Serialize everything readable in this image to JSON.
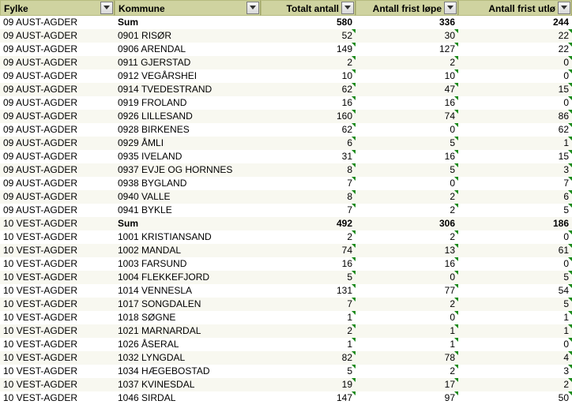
{
  "headers": {
    "fylke": "Fylke",
    "kommune": "Kommune",
    "totalt": "Totalt antall",
    "lope": "Antall frist løpe",
    "utlo": "Antall frist utlø"
  },
  "rows": [
    {
      "fylke": "09 AUST-AGDER",
      "kommune": "Sum",
      "totalt": "580",
      "lope": "336",
      "utlo": "244",
      "bold": true,
      "tick": false
    },
    {
      "fylke": "09 AUST-AGDER",
      "kommune": "0901 RISØR",
      "totalt": "52",
      "lope": "30",
      "utlo": "22",
      "bold": false,
      "tick": true
    },
    {
      "fylke": "09 AUST-AGDER",
      "kommune": "0906 ARENDAL",
      "totalt": "149",
      "lope": "127",
      "utlo": "22",
      "bold": false,
      "tick": true
    },
    {
      "fylke": "09 AUST-AGDER",
      "kommune": "0911 GJERSTAD",
      "totalt": "2",
      "lope": "2",
      "utlo": "0",
      "bold": false,
      "tick": true
    },
    {
      "fylke": "09 AUST-AGDER",
      "kommune": "0912 VEGÅRSHEI",
      "totalt": "10",
      "lope": "10",
      "utlo": "0",
      "bold": false,
      "tick": true
    },
    {
      "fylke": "09 AUST-AGDER",
      "kommune": "0914 TVEDESTRAND",
      "totalt": "62",
      "lope": "47",
      "utlo": "15",
      "bold": false,
      "tick": true
    },
    {
      "fylke": "09 AUST-AGDER",
      "kommune": "0919 FROLAND",
      "totalt": "16",
      "lope": "16",
      "utlo": "0",
      "bold": false,
      "tick": true
    },
    {
      "fylke": "09 AUST-AGDER",
      "kommune": "0926 LILLESAND",
      "totalt": "160",
      "lope": "74",
      "utlo": "86",
      "bold": false,
      "tick": true
    },
    {
      "fylke": "09 AUST-AGDER",
      "kommune": "0928 BIRKENES",
      "totalt": "62",
      "lope": "0",
      "utlo": "62",
      "bold": false,
      "tick": true
    },
    {
      "fylke": "09 AUST-AGDER",
      "kommune": "0929 ÅMLI",
      "totalt": "6",
      "lope": "5",
      "utlo": "1",
      "bold": false,
      "tick": true
    },
    {
      "fylke": "09 AUST-AGDER",
      "kommune": "0935 IVELAND",
      "totalt": "31",
      "lope": "16",
      "utlo": "15",
      "bold": false,
      "tick": true
    },
    {
      "fylke": "09 AUST-AGDER",
      "kommune": "0937 EVJE OG HORNNES",
      "totalt": "8",
      "lope": "5",
      "utlo": "3",
      "bold": false,
      "tick": true
    },
    {
      "fylke": "09 AUST-AGDER",
      "kommune": "0938 BYGLAND",
      "totalt": "7",
      "lope": "0",
      "utlo": "7",
      "bold": false,
      "tick": true
    },
    {
      "fylke": "09 AUST-AGDER",
      "kommune": "0940 VALLE",
      "totalt": "8",
      "lope": "2",
      "utlo": "6",
      "bold": false,
      "tick": true
    },
    {
      "fylke": "09 AUST-AGDER",
      "kommune": "0941 BYKLE",
      "totalt": "7",
      "lope": "2",
      "utlo": "5",
      "bold": false,
      "tick": true
    },
    {
      "fylke": "10 VEST-AGDER",
      "kommune": "Sum",
      "totalt": "492",
      "lope": "306",
      "utlo": "186",
      "bold": true,
      "tick": false
    },
    {
      "fylke": "10 VEST-AGDER",
      "kommune": "1001 KRISTIANSAND",
      "totalt": "2",
      "lope": "2",
      "utlo": "0",
      "bold": false,
      "tick": true
    },
    {
      "fylke": "10 VEST-AGDER",
      "kommune": "1002 MANDAL",
      "totalt": "74",
      "lope": "13",
      "utlo": "61",
      "bold": false,
      "tick": true
    },
    {
      "fylke": "10 VEST-AGDER",
      "kommune": "1003 FARSUND",
      "totalt": "16",
      "lope": "16",
      "utlo": "0",
      "bold": false,
      "tick": true
    },
    {
      "fylke": "10 VEST-AGDER",
      "kommune": "1004 FLEKKEFJORD",
      "totalt": "5",
      "lope": "0",
      "utlo": "5",
      "bold": false,
      "tick": true
    },
    {
      "fylke": "10 VEST-AGDER",
      "kommune": "1014 VENNESLA",
      "totalt": "131",
      "lope": "77",
      "utlo": "54",
      "bold": false,
      "tick": true
    },
    {
      "fylke": "10 VEST-AGDER",
      "kommune": "1017 SONGDALEN",
      "totalt": "7",
      "lope": "2",
      "utlo": "5",
      "bold": false,
      "tick": true
    },
    {
      "fylke": "10 VEST-AGDER",
      "kommune": "1018 SØGNE",
      "totalt": "1",
      "lope": "0",
      "utlo": "1",
      "bold": false,
      "tick": true
    },
    {
      "fylke": "10 VEST-AGDER",
      "kommune": "1021 MARNARDAL",
      "totalt": "2",
      "lope": "1",
      "utlo": "1",
      "bold": false,
      "tick": true
    },
    {
      "fylke": "10 VEST-AGDER",
      "kommune": "1026 ÅSERAL",
      "totalt": "1",
      "lope": "1",
      "utlo": "0",
      "bold": false,
      "tick": true
    },
    {
      "fylke": "10 VEST-AGDER",
      "kommune": "1032 LYNGDAL",
      "totalt": "82",
      "lope": "78",
      "utlo": "4",
      "bold": false,
      "tick": true
    },
    {
      "fylke": "10 VEST-AGDER",
      "kommune": "1034 HÆGEBOSTAD",
      "totalt": "5",
      "lope": "2",
      "utlo": "3",
      "bold": false,
      "tick": true
    },
    {
      "fylke": "10 VEST-AGDER",
      "kommune": "1037 KVINESDAL",
      "totalt": "19",
      "lope": "17",
      "utlo": "2",
      "bold": false,
      "tick": true
    },
    {
      "fylke": "10 VEST-AGDER",
      "kommune": "1046 SIRDAL",
      "totalt": "147",
      "lope": "97",
      "utlo": "50",
      "bold": false,
      "tick": true
    }
  ]
}
